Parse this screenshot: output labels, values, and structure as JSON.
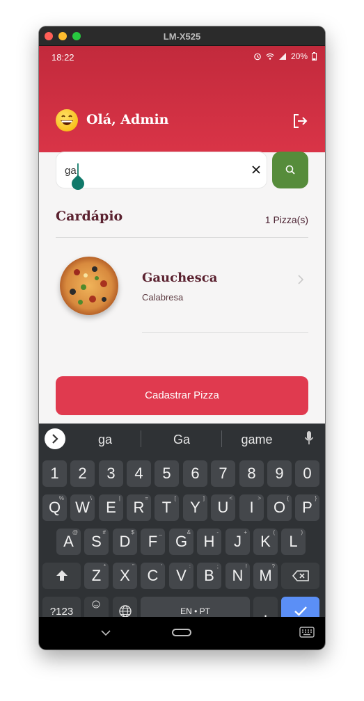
{
  "window": {
    "title": "LM-X525"
  },
  "status_bar": {
    "time": "18:22",
    "battery": "20%"
  },
  "header": {
    "greeting": "Olá, Admin"
  },
  "search": {
    "value": "ga"
  },
  "menu": {
    "title": "Cardápio",
    "count": "1 Pizza(s)"
  },
  "pizzas": [
    {
      "name": "Gauchesca",
      "description": "Calabresa"
    }
  ],
  "actions": {
    "register_label": "Cadastrar Pizza"
  },
  "keyboard": {
    "suggestions": [
      "ga",
      "Ga",
      "game"
    ],
    "row_numbers": [
      "1",
      "2",
      "3",
      "4",
      "5",
      "6",
      "7",
      "8",
      "9",
      "0"
    ],
    "row1": [
      "Q",
      "W",
      "E",
      "R",
      "T",
      "Y",
      "U",
      "I",
      "O",
      "P"
    ],
    "row1_sub": [
      "%",
      "\\",
      "|",
      "=",
      "[",
      "]",
      "<",
      ">",
      "{",
      "}"
    ],
    "row2": [
      "A",
      "S",
      "D",
      "F",
      "G",
      "H",
      "J",
      "K",
      "L"
    ],
    "row2_sub": [
      "@",
      "#",
      "$",
      "_",
      "&",
      "-",
      "+",
      "(",
      ")"
    ],
    "row3": [
      "Z",
      "X",
      "C",
      "V",
      "B",
      "N",
      "M"
    ],
    "row3_sub": [
      "*",
      "\"",
      "'",
      ":",
      ";",
      "!",
      "?"
    ],
    "symbols_label": "?123",
    "comma_label": ",",
    "space_label": "EN • PT",
    "period_label": "."
  },
  "colors": {
    "header": "#d93447",
    "search_button": "#568c3b",
    "primary_button": "#e03a4f",
    "heading": "#5b2230",
    "keyboard_bg": "#2f3235",
    "enter_key": "#5b8ff6"
  }
}
